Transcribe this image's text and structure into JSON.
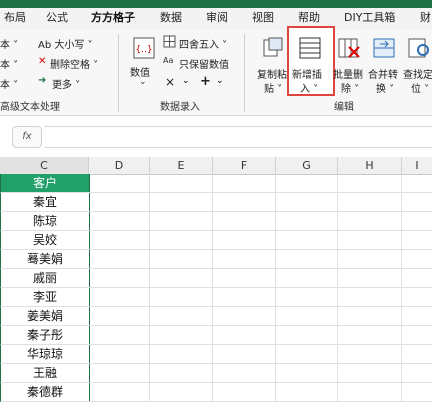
{
  "tabs": [
    "布局",
    "公式",
    "方方格子",
    "数据",
    "审阅",
    "视图",
    "帮助",
    "DIY工具箱",
    "财"
  ],
  "active_tab": "方方格子",
  "ribbon": {
    "text_group": {
      "items": [
        "本 ˅",
        "本 ˅",
        "本 ˅",
        "Ab 大小写 ˅",
        "删除空格 ˅",
        "更多 ˅"
      ],
      "label": "高级文本处理"
    },
    "numeric_group": {
      "value_label": "数值",
      "round_label": "四舍五入 ˅",
      "keep_value_label": "只保留数值",
      "times_label": "×",
      "plus_label": "+",
      "label": "数据录入"
    },
    "edit_group": {
      "copy_paste_line1": "复制粘",
      "copy_paste_line2": "贴 ˅",
      "new_insert_line1": "新增插",
      "new_insert_line2": "入 ˅",
      "batch_delete_line1": "批量删",
      "batch_delete_line2": "除 ˅",
      "merge_convert_line1": "合并转",
      "merge_convert_line2": "换 ˅",
      "find_locate_line1": "查找定",
      "find_locate_line2": "位 ˅",
      "label": "编辑"
    }
  },
  "formula_bar": {
    "fx_label": "fx",
    "value": ""
  },
  "columns": [
    "C",
    "D",
    "E",
    "F",
    "G",
    "H",
    "I"
  ],
  "selected_column": "C",
  "cells_c": [
    "客户",
    "秦宜",
    "陈琼",
    "吴姣",
    "蓦美娟",
    "戚丽",
    "李亚",
    "姜美娟",
    "秦子彤",
    "华琼琼",
    "王融",
    "秦德群"
  ],
  "colors": {
    "accent": "#1e7145",
    "header_fill": "#21a06a",
    "highlight_box": "#e0443e"
  }
}
